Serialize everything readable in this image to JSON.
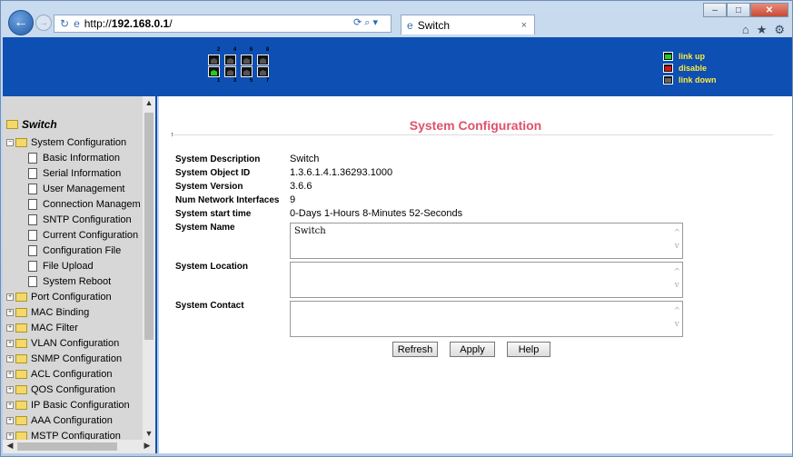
{
  "browser": {
    "url_prefix": "http://",
    "url_host": "192.168.0.1",
    "url_suffix": "/",
    "tab_title": "Switch",
    "tab_close": "×",
    "search_tools": "⟳ ⌕ ▾"
  },
  "banner": {
    "port_numbers_top": [
      "2",
      "4",
      "6",
      "8"
    ],
    "port_numbers_bottom": [
      "1",
      "3",
      "5",
      "7"
    ],
    "ports_top": [
      "down",
      "down",
      "down",
      "down"
    ],
    "ports_bottom": [
      "up",
      "down",
      "down",
      "down"
    ],
    "legend": [
      {
        "label": "link up",
        "state": "up"
      },
      {
        "label": "disable",
        "state": "dis"
      },
      {
        "label": "link down",
        "state": "down"
      }
    ]
  },
  "sidebar": {
    "root": "Switch",
    "groups": [
      {
        "label": "System Configuration",
        "expanded": true,
        "children": [
          "Basic Information",
          "Serial Information",
          "User Management",
          "Connection Managem",
          "SNTP Configuration",
          "Current Configuration",
          "Configuration File",
          "File Upload",
          "System Reboot"
        ]
      },
      {
        "label": "Port Configuration"
      },
      {
        "label": "MAC Binding"
      },
      {
        "label": "MAC Filter"
      },
      {
        "label": "VLAN Configuration"
      },
      {
        "label": "SNMP Configuration"
      },
      {
        "label": "ACL Configuration"
      },
      {
        "label": "QOS Configuration"
      },
      {
        "label": "IP Basic Configuration"
      },
      {
        "label": "AAA Configuration"
      },
      {
        "label": "MSTP Configuration"
      }
    ]
  },
  "main": {
    "title": "System Configuration",
    "rows": [
      {
        "label": "System Description",
        "value": "Switch"
      },
      {
        "label": "System Object ID",
        "value": "1.3.6.1.4.1.36293.1000"
      },
      {
        "label": "System Version",
        "value": "3.6.6"
      },
      {
        "label": "Num Network Interfaces",
        "value": "9"
      },
      {
        "label": "System start time",
        "value": "0-Days 1-Hours 8-Minutes 52-Seconds"
      }
    ],
    "system_name_label": "System Name",
    "system_name_value": "Switch",
    "system_location_label": "System Location",
    "system_location_value": "",
    "system_contact_label": "System Contact",
    "system_contact_value": "",
    "buttons": {
      "refresh": "Refresh",
      "apply": "Apply",
      "help": "Help"
    }
  }
}
